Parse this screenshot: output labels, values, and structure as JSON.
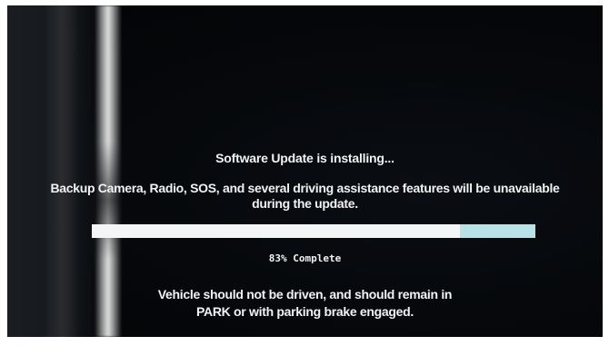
{
  "update_screen": {
    "title": "Software Update is installing...",
    "message_line1": "Backup Camera, Radio, SOS, and several driving assistance features will be unavailable",
    "message_line2": "during the update.",
    "progress_fraction": 0.83,
    "progress_text": "83% Complete",
    "warning_line1": "Vehicle should not be driven, and should remain in",
    "warning_line2": "PARK or with parking brake engaged."
  },
  "colors": {
    "screen_background": "#05070a",
    "text": "#f2f2f2",
    "progress_fill": "#f4f6f6",
    "progress_track": "#b9e1e6"
  }
}
